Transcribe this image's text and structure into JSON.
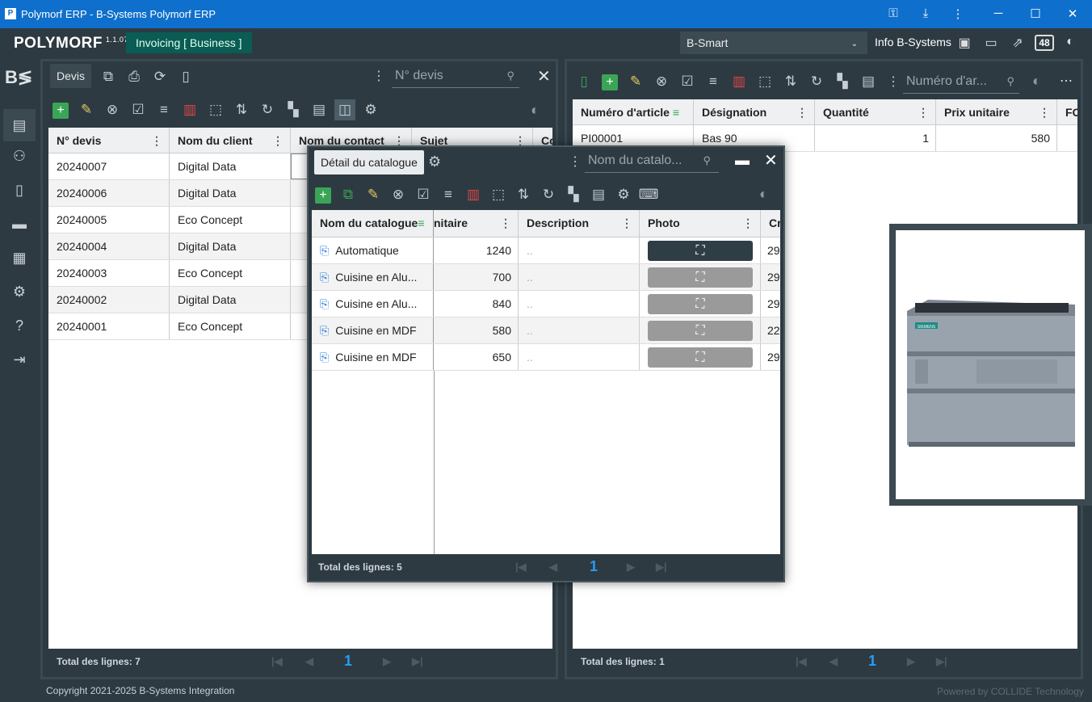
{
  "window": {
    "title": "Polymorf ERP - B-Systems Polymorf ERP"
  },
  "app": {
    "brand": "POLYMORF",
    "version": "1.1.07",
    "module": "Invoicing [ Business ]",
    "company": "B-Smart",
    "info": "Info B-Systems",
    "badge": "48"
  },
  "left": {
    "tab": "Devis",
    "search_placeholder": "N° devis",
    "columns": [
      "N° devis",
      "Nom du client",
      "Nom du contact",
      "Sujet",
      "Co"
    ],
    "rows": [
      [
        "20240007",
        "Digital Data"
      ],
      [
        "20240006",
        "Digital Data"
      ],
      [
        "20240005",
        "Eco Concept"
      ],
      [
        "20240004",
        "Digital Data"
      ],
      [
        "20240003",
        "Eco Concept"
      ],
      [
        "20240002",
        "Digital Data"
      ],
      [
        "20240001",
        "Eco Concept"
      ]
    ],
    "total": "Total des lignes: 7",
    "page": "1"
  },
  "right": {
    "search_placeholder": "Numéro d'ar...",
    "columns": [
      "Numéro d'article",
      "Désignation",
      "Quantité",
      "Prix unitaire",
      "FO"
    ],
    "rows": [
      [
        "PI00001",
        "Bas 90",
        "1",
        "580"
      ]
    ],
    "total": "Total des lignes: 1",
    "page": "1"
  },
  "modal": {
    "tab": "Détail du catalogue",
    "search_placeholder": "Nom du catalo...",
    "columns": [
      "Nom du catalogue",
      "nitaire",
      "Description",
      "Photo",
      "Cr"
    ],
    "rows": [
      {
        "name": "Automatique",
        "price": "1240",
        "desc": "..",
        "cr": "29"
      },
      {
        "name": "Cuisine en Alu...",
        "price": "700",
        "desc": "..",
        "cr": "29"
      },
      {
        "name": "Cuisine en Alu...",
        "price": "840",
        "desc": "..",
        "cr": "29"
      },
      {
        "name": "Cuisine en MDF",
        "price": "580",
        "desc": "..",
        "cr": "22"
      },
      {
        "name": "Cuisine en MDF",
        "price": "650",
        "desc": "..",
        "cr": "29"
      }
    ],
    "total": "Total des lignes: 5",
    "page": "1"
  },
  "footer": {
    "copyright": "Copyright 2021-2025 B-Systems Integration",
    "powered": "Powered by COLLIDE Technology"
  },
  "image_preview": {
    "logo_text": "SIEMENS"
  }
}
